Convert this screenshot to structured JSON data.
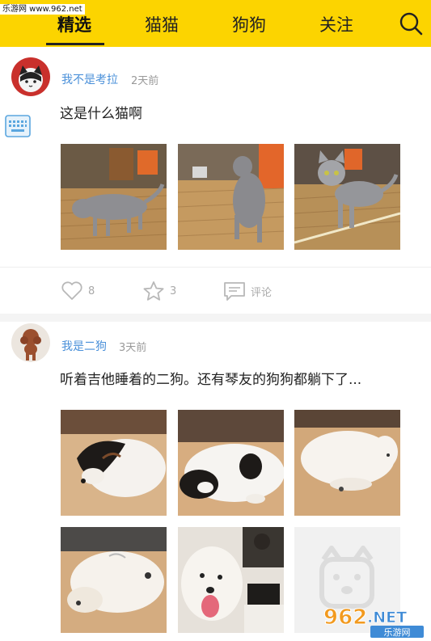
{
  "watermark": "乐游网 www.962.net",
  "tabs": [
    {
      "label": "精选",
      "active": true
    },
    {
      "label": "猫猫",
      "active": false
    },
    {
      "label": "狗狗",
      "active": false
    },
    {
      "label": "关注",
      "active": false
    }
  ],
  "icons": {
    "search": "search-icon",
    "like": "heart-icon",
    "favorite": "star-icon",
    "comment": "comment-icon",
    "keyboard": "keyboard-icon"
  },
  "colors": {
    "header": "#fcd400",
    "username": "#4a90d9",
    "muted": "#999999"
  },
  "posts": [
    {
      "username": "我不是考拉",
      "time": "2天前",
      "content": "这是什么猫啊",
      "likes": "8",
      "favorites": "3",
      "comment_label": "评论"
    },
    {
      "username": "我是二狗",
      "time": "3天前",
      "content": "听着吉他睡着的二狗。还有琴友的狗狗都躺下了..."
    }
  ],
  "logo": {
    "brand": "962.NET",
    "sub": "乐游网"
  }
}
